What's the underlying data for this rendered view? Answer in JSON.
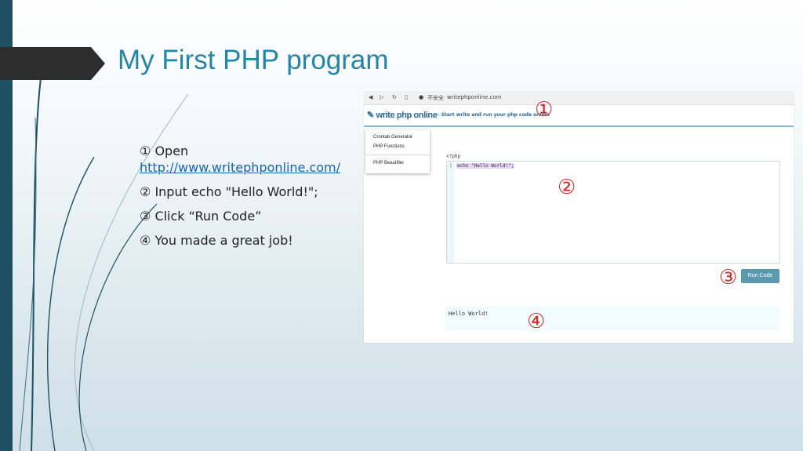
{
  "slide": {
    "title": "My First PHP program",
    "bullets": [
      {
        "num": "①",
        "text": "Open",
        "link": "http://www.writephponline.com/"
      },
      {
        "num": "②",
        "text": "Input  echo \"Hello World!\";"
      },
      {
        "num": "③",
        "text": "Click “Run Code”"
      },
      {
        "num": "④",
        "text": "You made a great job!"
      }
    ],
    "bullet_mark": ""
  },
  "browser": {
    "security": "不安全",
    "url": "writephponline.com"
  },
  "site": {
    "logo": "write php online",
    "tagline": "- Start write and run your php code online",
    "menu": [
      "Crontab Generator",
      "PHP Functions",
      "PHP Beautifier"
    ],
    "php_open": "<?php",
    "line_number": "1",
    "code": "echo \"Hello World!\";",
    "run_button": "Run Code",
    "output": "Hello World!"
  },
  "annotations": [
    "①",
    "②",
    "③",
    "④"
  ],
  "colors": {
    "title": "#2186a8",
    "accent_bar": "#1f4f63",
    "callout": "#d12a2a",
    "run_button": "#5b9aae"
  }
}
